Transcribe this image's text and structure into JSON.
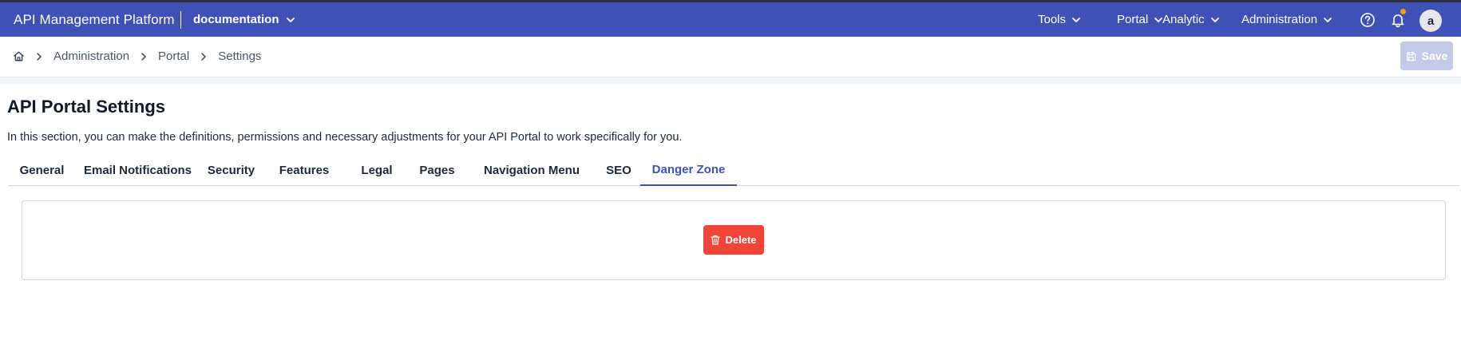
{
  "topbar": {
    "app_title": "API Management Platform",
    "workspace": "documentation",
    "menus": [
      "Tools",
      "Portal",
      "Analytic",
      "Administration"
    ],
    "icons": [
      "help-icon",
      "bell-icon",
      "chevron-down-icon"
    ],
    "avatar_initial": "a",
    "background_color": "#3f51b5",
    "notification_dot_color": "#f59e0b"
  },
  "breadcrumb": {
    "home_icon": "home-icon",
    "items": [
      "Administration",
      "Portal",
      "Settings"
    ]
  },
  "toolbar": {
    "save_label": "Save",
    "save_icon": "save-icon",
    "save_state": "disabled"
  },
  "page": {
    "title": "API Portal Settings",
    "description": "In this section, you can make the definitions, permissions and necessary adjustments for your API Portal to work specifically for you."
  },
  "tabs": {
    "items": [
      "General",
      "Email Notifications",
      "Security",
      "Features",
      "Legal",
      "Pages",
      "Navigation Menu",
      "SEO",
      "Danger Zone"
    ],
    "active": "Danger Zone",
    "active_color": "#3f51b5"
  },
  "danger_zone": {
    "delete_label": "Delete",
    "delete_icon": "trash-icon",
    "delete_color": "#f04438"
  }
}
